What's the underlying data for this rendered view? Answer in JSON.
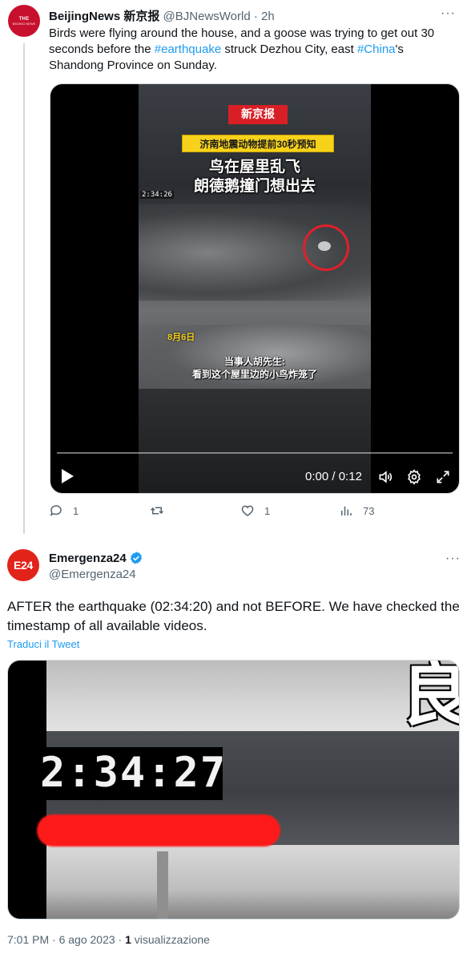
{
  "colors": {
    "link": "#1d9bf0",
    "secondary": "#536471",
    "text": "#0f1419",
    "brand_red": "#c8102e"
  },
  "tweet1": {
    "avatar_text": [
      "THE",
      "BEIJING NEWS"
    ],
    "display_name": "BeijingNews 新京报",
    "handle": "@BJNewsWorld",
    "separator": "·",
    "time": "2h",
    "more_icon": "more-horizontal-icon",
    "text_parts": {
      "a": "Birds were flying around the house, and a goose was trying to get out 30 seconds before the ",
      "tag1": "#earthquake",
      "b": " struck Dezhou City, east ",
      "tag2": "#China",
      "c": "'s Shandong Province on Sunday."
    },
    "video": {
      "logo": "新京报",
      "banner": "济南地震动物提前30秒预知",
      "caption_line1": "鸟在屋里乱飞",
      "caption_line2": "朗德鹅撞门想出去",
      "timestamp": "2:34:26",
      "date_overlay": "8月6日",
      "subtitle_line1": "当事人胡先生:",
      "subtitle_line2": "看到这个屋里边的小鸟炸笼了",
      "current_time": "0:00",
      "duration": "0:12",
      "progress": 0.0
    },
    "actions": {
      "replies": "1",
      "retweets": "",
      "likes": "1",
      "views": "73"
    }
  },
  "tweet2": {
    "avatar_text": "E24",
    "display_name": "Emergenza24",
    "handle": "@Emergenza24",
    "text": "AFTER the earthquake (02:34:20) and not BEFORE. We have checked the timestamp of all available videos.",
    "translate_label": "Traduci il Tweet",
    "image": {
      "timestamp": "2:34:27",
      "char": "良"
    },
    "meta_time": "7:01 PM · 6 ago 2023 · ",
    "meta_views_count": "1",
    "meta_views_label": " visualizzazione"
  }
}
